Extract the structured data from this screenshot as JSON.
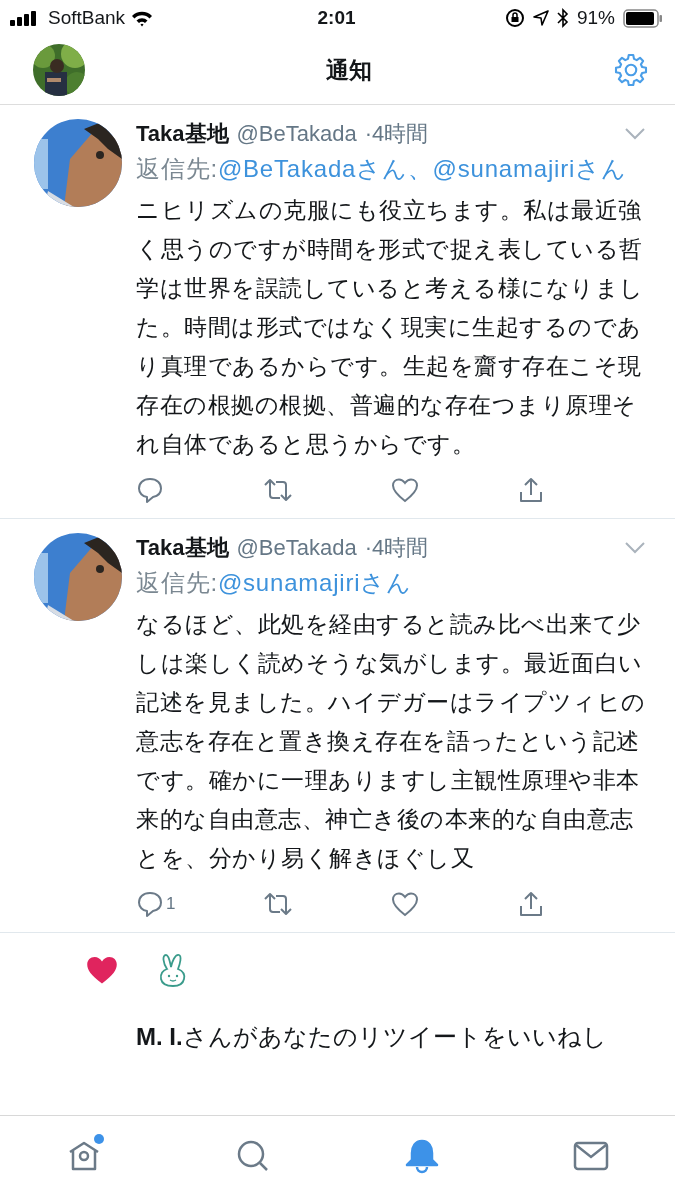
{
  "status_bar": {
    "carrier": "SoftBank",
    "time": "2:01",
    "battery": "91%"
  },
  "header": {
    "title": "通知"
  },
  "tweets": [
    {
      "name": "Taka基地",
      "handle": "@BeTakada",
      "time": "·4時間",
      "reply_label": "返信先:",
      "mentions": [
        "@BeTakadaさん、",
        "@sunamajiriさん"
      ],
      "text": "ニヒリズムの克服にも役立ちます。私は最近強く思うのですが時間を形式で捉え表している哲学は世界を誤読していると考える様になりました。時間は形式ではなく現実に生起するのであり真理であるからです。生起を齎す存在こそ現存在の根拠の根拠、普遍的な存在つまり原理それ自体であると思うからです。",
      "actions": [
        {
          "kind": "reply"
        },
        {
          "kind": "retweet"
        },
        {
          "kind": "like"
        },
        {
          "kind": "share"
        }
      ]
    },
    {
      "name": "Taka基地",
      "handle": "@BeTakada",
      "time": "·4時間",
      "reply_label": "返信先:",
      "mentions": [
        "@sunamajiriさん"
      ],
      "text": "なるほど、此処を経由すると読み比べ出来て少しは楽しく読めそうな気がします。最近面白い記述を見ました。ハイデガーはライプツィヒの意志を存在と置き換え存在を語ったという記述です。確かに一理ありますし主観性原理や非本来的な自由意志、神亡き後の本来的な自由意志とを、分かり易く解きほぐし又",
      "actions": [
        {
          "kind": "reply",
          "count": "1"
        },
        {
          "kind": "retweet"
        },
        {
          "kind": "like"
        },
        {
          "kind": "share"
        }
      ]
    }
  ],
  "notification": {
    "text": "**M. I.**さんがあなたのリツイートをいいねし"
  },
  "tab_bar": [
    {
      "kind": "home",
      "selected": false,
      "badge": true
    },
    {
      "kind": "search",
      "selected": false,
      "badge": false
    },
    {
      "kind": "notifications",
      "selected": true,
      "badge": false
    },
    {
      "kind": "messages",
      "selected": false,
      "badge": false
    }
  ]
}
